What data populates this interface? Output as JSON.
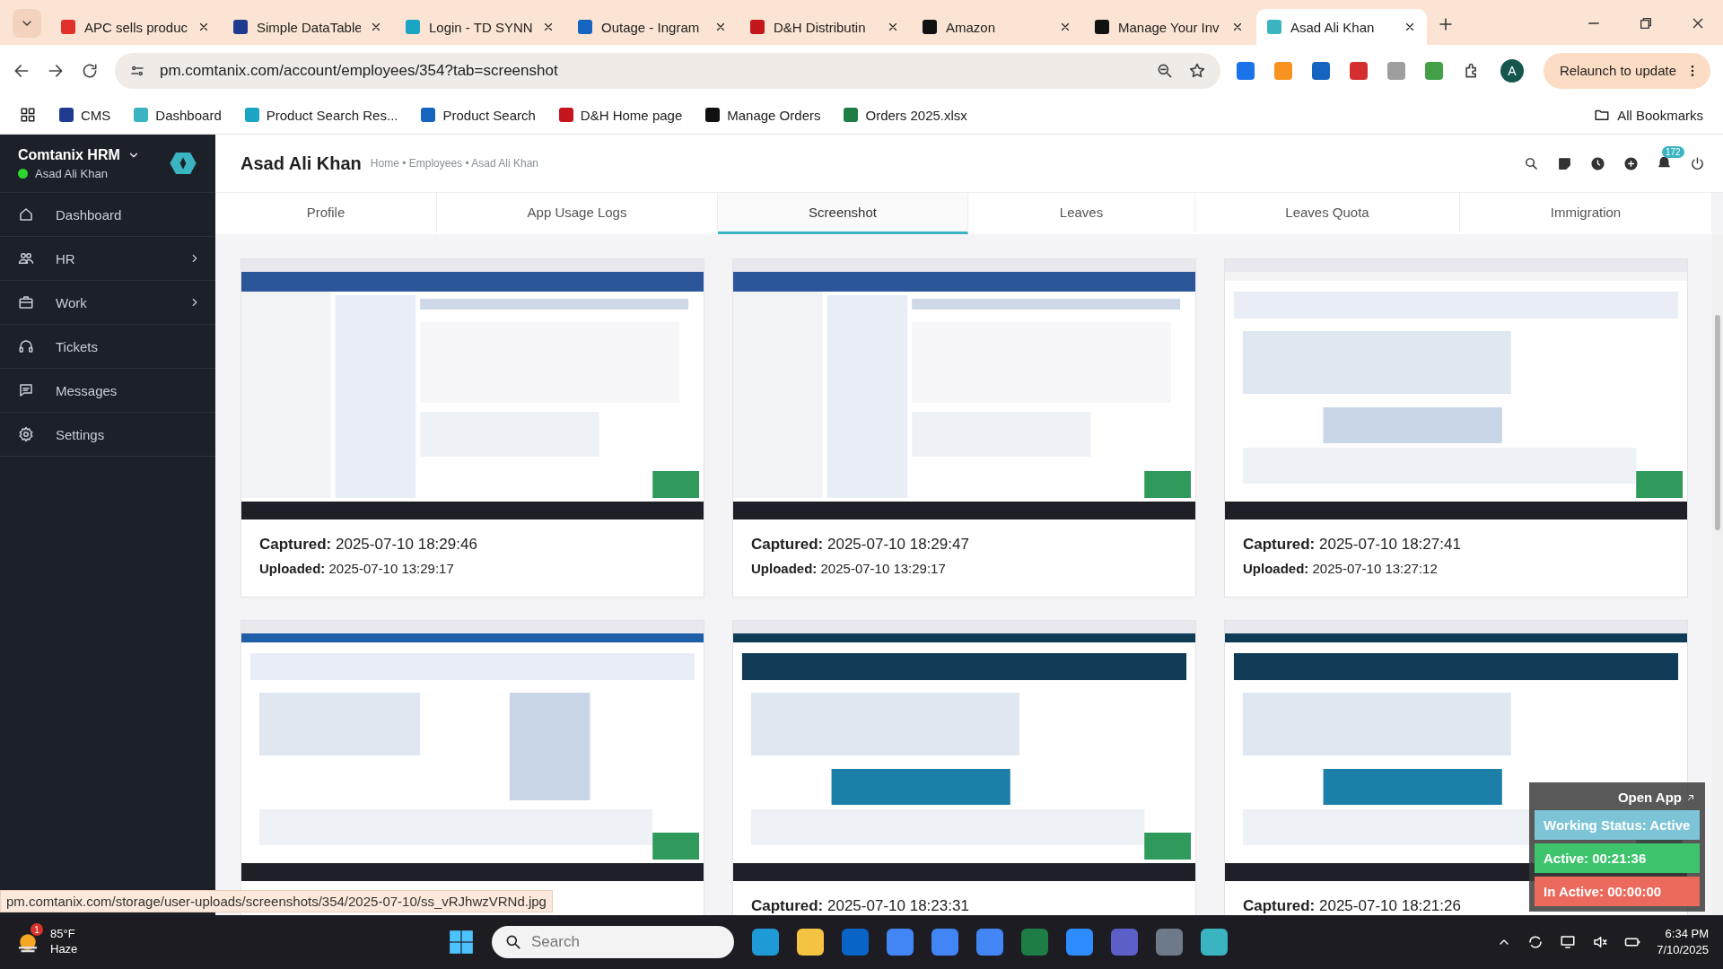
{
  "browser": {
    "tabs": [
      {
        "title": "APC sells produc",
        "color": "#e0312b",
        "selected": false
      },
      {
        "title": "Simple DataTable",
        "color": "#1f3b8f",
        "selected": false
      },
      {
        "title": "Login - TD SYNN",
        "color": "#1aa5c4",
        "selected": false
      },
      {
        "title": "Outage - Ingram",
        "color": "#1565c0",
        "selected": false
      },
      {
        "title": "D&H Distributin",
        "color": "#c4161c",
        "selected": false
      },
      {
        "title": "Amazon",
        "color": "#111111",
        "selected": false
      },
      {
        "title": "Manage Your Inv",
        "color": "#111111",
        "selected": false
      },
      {
        "title": "Asad Ali Khan",
        "color": "#3bb4c1",
        "selected": true
      }
    ],
    "url": "pm.comtanix.com/account/employees/354?tab=screenshot",
    "profile_initial": "A",
    "relaunch_button": "Relaunch to update",
    "bookmarks": [
      {
        "label": "CMS",
        "color": "#1f3b8f"
      },
      {
        "label": "Dashboard",
        "color": "#3bb4c1"
      },
      {
        "label": "Product Search Res...",
        "color": "#1aa5c4"
      },
      {
        "label": "Product Search",
        "color": "#1565c0"
      },
      {
        "label": "D&H Home page",
        "color": "#c4161c"
      },
      {
        "label": "Manage Orders",
        "color": "#111111"
      },
      {
        "label": "Orders 2025.xlsx",
        "color": "#1e7d45"
      }
    ],
    "all_bookmarks": "All Bookmarks",
    "status_url": "pm.comtanix.com/storage/user-uploads/screenshots/354/2025-07-10/ss_vRJhwzVRNd.jpg"
  },
  "sidebar": {
    "brand": "Comtanix HRM",
    "user": "Asad Ali Khan",
    "online": true,
    "items": [
      {
        "label": "Dashboard",
        "submenu": false
      },
      {
        "label": "HR",
        "submenu": true
      },
      {
        "label": "Work",
        "submenu": true
      },
      {
        "label": "Tickets",
        "submenu": false
      },
      {
        "label": "Messages",
        "submenu": false
      },
      {
        "label": "Settings",
        "submenu": false
      }
    ]
  },
  "header": {
    "title": "Asad Ali Khan",
    "breadcrumb": "Home • Employees • Asad Ali Khan",
    "notification_count": "172"
  },
  "tabs": [
    {
      "label": "Profile",
      "selected": false
    },
    {
      "label": "App Usage Logs",
      "selected": false
    },
    {
      "label": "Screenshot",
      "selected": true
    },
    {
      "label": "Leaves",
      "selected": false
    },
    {
      "label": "Leaves Quota",
      "selected": false
    },
    {
      "label": "Immigration",
      "selected": false
    }
  ],
  "screenshots": [
    {
      "kind": "picture",
      "captured": "**Captured:** 2025-07-10 18:29:46",
      "uploaded": "**Uploaded:** 2025-07-10 13:29:17"
    },
    {
      "kind": "picture",
      "captured": "**Captured:** 2025-07-10 18:29:47",
      "uploaded": "**Uploaded:** 2025-07-10 13:29:17"
    },
    {
      "kind": "picture",
      "captured": "**Captured:** 2025-07-10 18:27:41",
      "uploaded": "**Uploaded:** 2025-07-10 13:27:12"
    },
    {
      "kind": "picture"
    },
    {
      "kind": "picture",
      "captured": "**Captured:** 2025-07-10 18:23:31"
    },
    {
      "kind": "picture",
      "captured": "**Captured:** 2025-07-10 18:21:26"
    }
  ],
  "tracker": {
    "open_app": "Open App",
    "working_status": "Working Status: Active",
    "active": "Active: 00:21:36",
    "inactive": "In Active: 00:00:00"
  },
  "taskbar": {
    "weather_badge": "1",
    "temperature": "85°F",
    "condition": "Haze",
    "search_placeholder": "Search",
    "time": "6:34 PM",
    "date": "7/10/2025"
  }
}
